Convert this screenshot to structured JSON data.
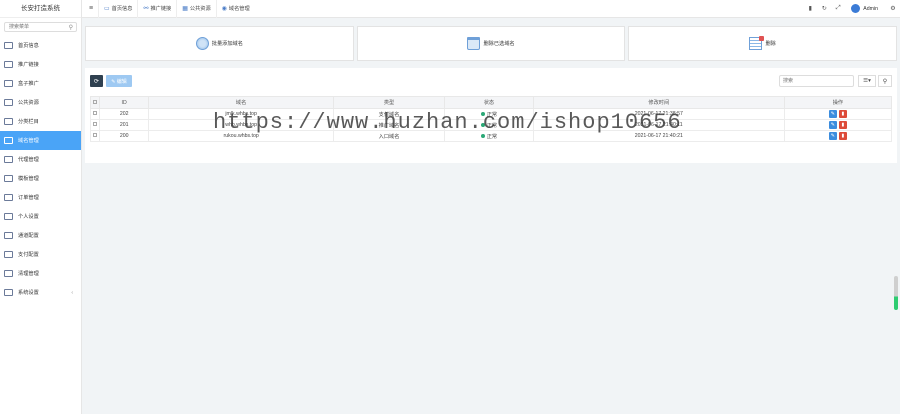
{
  "brand": "长安打造系统",
  "sidebar": {
    "search_placeholder": "搜索菜单",
    "items": [
      {
        "label": "首页信息",
        "icon": "monitor-icon",
        "active": false
      },
      {
        "label": "推广链接",
        "icon": "link-icon",
        "active": false
      },
      {
        "label": "盒子推广",
        "icon": "box-icon",
        "active": false
      },
      {
        "label": "公共资源",
        "icon": "grid-icon",
        "active": false
      },
      {
        "label": "分类栏目",
        "icon": "list-icon",
        "active": false
      },
      {
        "label": "域名管理",
        "icon": "globe-icon",
        "active": true
      },
      {
        "label": "代理管理",
        "icon": "users-icon",
        "active": false
      },
      {
        "label": "模板管理",
        "icon": "template-icon",
        "active": false
      },
      {
        "label": "订单管理",
        "icon": "order-icon",
        "active": false
      },
      {
        "label": "个人设置",
        "icon": "user-card-icon",
        "active": false
      },
      {
        "label": "通道配置",
        "icon": "channel-icon",
        "active": false
      },
      {
        "label": "支付配置",
        "icon": "gear-icon",
        "active": false
      },
      {
        "label": "清理管理",
        "icon": "gear-icon",
        "active": false
      },
      {
        "label": "系统设置",
        "icon": "settings-icon",
        "active": false,
        "has_arrow": true
      }
    ]
  },
  "topbar": {
    "tabs": [
      {
        "label": "首页信息",
        "icon": "monitor-icon"
      },
      {
        "label": "推广链接",
        "icon": "link-icon"
      },
      {
        "label": "公共资源",
        "icon": "grid-icon"
      },
      {
        "label": "域名管理",
        "icon": "globe-icon"
      }
    ],
    "user": "Admin"
  },
  "actions": {
    "batch_add": "批量添加域名",
    "delete_rows": "删除已选域名",
    "delete": "删除"
  },
  "toolbar": {
    "refresh_icon": "⟳",
    "edit_label": "✎ 编辑",
    "search_placeholder": "搜索"
  },
  "table": {
    "headers": [
      "ID",
      "域名",
      "类型",
      "状态",
      "修改时间",
      "操作"
    ],
    "rows": [
      {
        "id": "202",
        "domain": "jmlk.whbs.top",
        "type": "支付域名",
        "type_color": "red",
        "status": "正常",
        "time": "2021-06-17 21:38:57"
      },
      {
        "id": "201",
        "domain": "whb.whbs.top",
        "type": "推广域名",
        "type_color": "green",
        "status": "正常",
        "time": "2021-06-17 21:40:11"
      },
      {
        "id": "200",
        "domain": "rukou.whbs.top",
        "type": "入口域名",
        "type_color": "orange",
        "status": "正常",
        "time": "2021-06-17 21:40:21"
      }
    ]
  },
  "watermark": "https://www.huzhan.com/ishop10656",
  "colors": {
    "active": "#4aa4f7",
    "dark": "#2f4050",
    "edit": "#3c8dde",
    "delete": "#dd4b39",
    "ok": "#2aa876"
  }
}
